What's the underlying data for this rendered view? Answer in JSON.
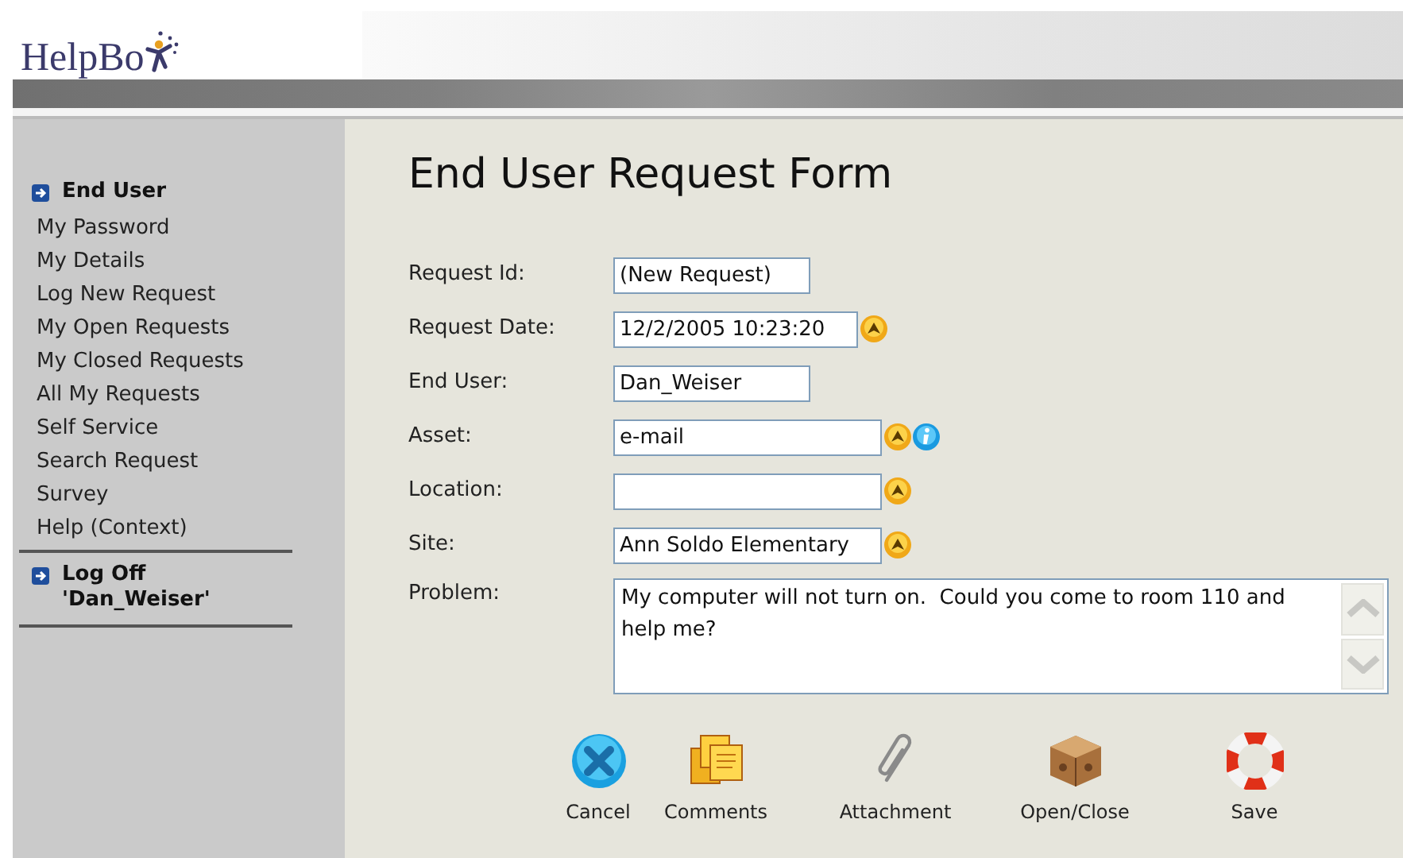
{
  "logo": {
    "text": "HelpBo"
  },
  "sidebar": {
    "sections": [
      {
        "title": "End User",
        "items": [
          "My Password",
          "My Details",
          "Log New Request",
          "My Open Requests",
          "My Closed Requests",
          "All My Requests",
          "Self Service",
          "Search Request",
          "Survey",
          "Help (Context)"
        ]
      },
      {
        "title": "Log Off\n'Dan_Weiser'"
      }
    ]
  },
  "form": {
    "title": "End User Request Form",
    "fields": [
      {
        "label": "Request Id:",
        "value": "(New Request)",
        "lookup": false,
        "info": false
      },
      {
        "label": "Request Date:",
        "value": "12/2/2005 10:23:20",
        "lookup": true,
        "info": false
      },
      {
        "label": "End User:",
        "value": "Dan_Weiser",
        "lookup": false,
        "info": false
      },
      {
        "label": "Asset:",
        "value": "e-mail",
        "lookup": true,
        "info": true
      },
      {
        "label": "Location:",
        "lookup": true,
        "info": false
      },
      {
        "label": "Site:",
        "value": "Ann Soldo Elementary",
        "lookup": true,
        "info": false
      }
    ],
    "problem": {
      "label": "Problem:",
      "value": "My computer will not turn on.  Could you come to room 110 and help me?"
    }
  },
  "toolbar": [
    {
      "kind": "cancel",
      "label": "Cancel"
    },
    {
      "kind": "comments",
      "label": "Comments"
    },
    {
      "kind": "attachment",
      "label": "Attachment"
    },
    {
      "kind": "openclose",
      "label": "Open/Close"
    },
    {
      "kind": "save",
      "label": "Save"
    }
  ]
}
